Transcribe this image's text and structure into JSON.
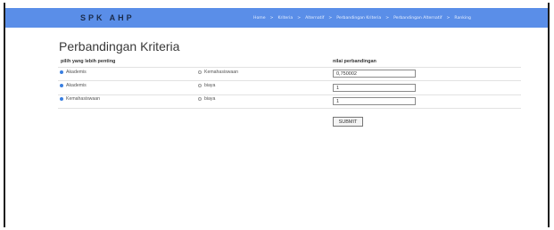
{
  "navbar": {
    "brand": "SPK AHP",
    "links": [
      "Home",
      "Kriteria",
      "Alternatif",
      "Perbandingan Kriteria",
      "Perbandingan Alternatif",
      "Ranking"
    ],
    "separator": ">",
    "color": "#5a8ee8"
  },
  "main": {
    "title": "Perbandingan Kriteria",
    "column_choice": "pilih yang lebih penting",
    "column_value": "nilai perbandingan",
    "rows": [
      {
        "option_a": "Akademis",
        "option_b": "Kemahasiswaan",
        "selected": "a",
        "value": "0,750002"
      },
      {
        "option_a": "Akademis",
        "option_b": "biaya",
        "selected": "a",
        "value": "1"
      },
      {
        "option_a": "Kemahasiswaan",
        "option_b": "biaya",
        "selected": "a",
        "value": "1"
      }
    ],
    "submit_label": "SUBMIT"
  }
}
